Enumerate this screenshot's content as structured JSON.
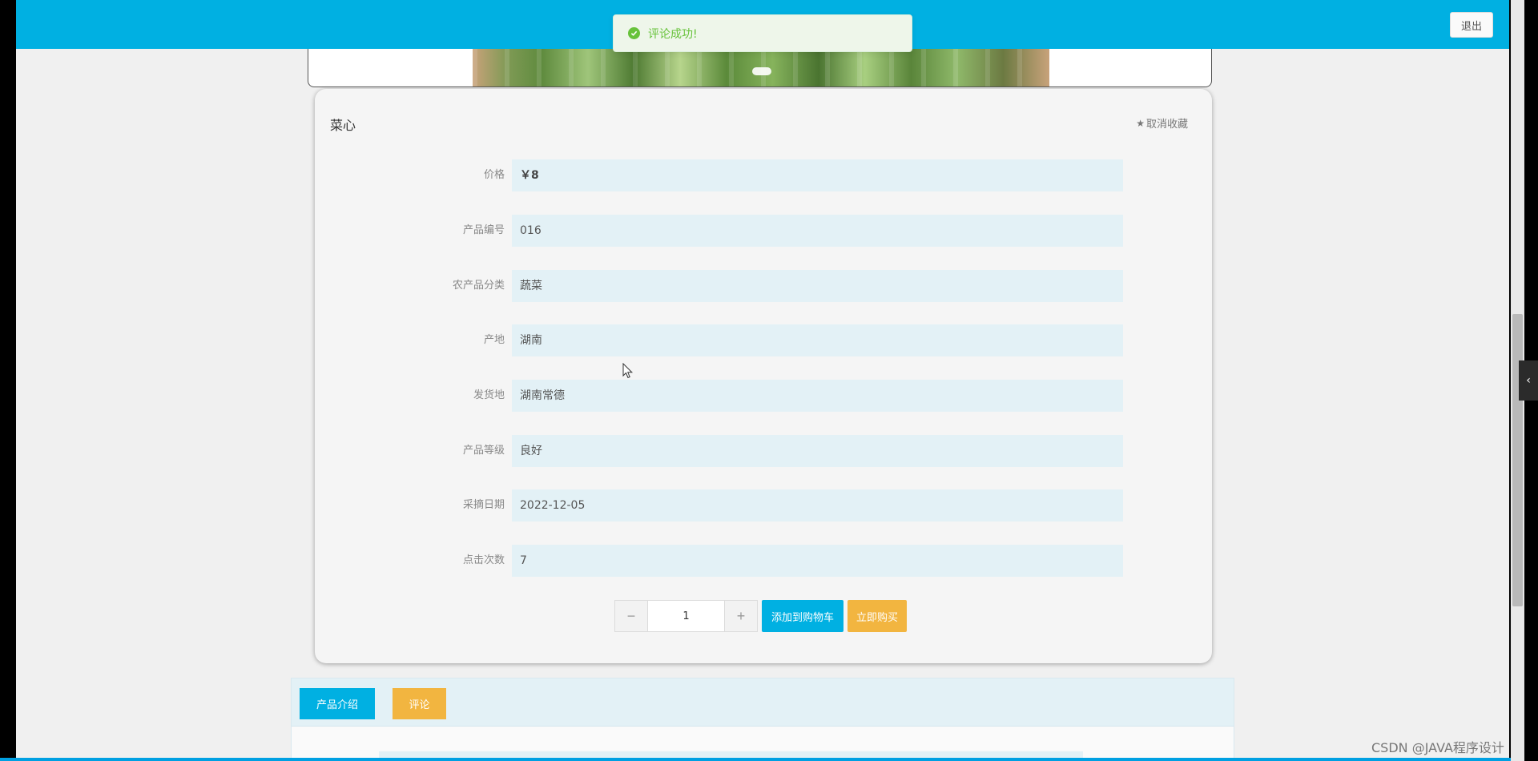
{
  "topbar": {
    "logout_label": "退出",
    "accent": "#00b0e2"
  },
  "toast": {
    "message": "评论成功!",
    "icon": "check-circle-icon",
    "color": "#67c23a"
  },
  "product": {
    "name": "菜心",
    "favorite_label": "取消收藏",
    "fields": [
      {
        "label": "价格",
        "value": "￥8"
      },
      {
        "label": "产品编号",
        "value": "016"
      },
      {
        "label": "农产品分类",
        "value": "蔬菜"
      },
      {
        "label": "产地",
        "value": "湖南"
      },
      {
        "label": "发货地",
        "value": "湖南常德"
      },
      {
        "label": "产品等级",
        "value": "良好"
      },
      {
        "label": "采摘日期",
        "value": "2022-12-05"
      },
      {
        "label": "点击次数",
        "value": "7"
      }
    ],
    "quantity": "1",
    "minus_symbol": "−",
    "plus_symbol": "+",
    "add_to_cart_label": "添加到购物车",
    "buy_now_label": "立即购买"
  },
  "tabs": {
    "intro_label": "产品介绍",
    "comments_label": "评论"
  },
  "watermark": "CSDN @JAVA程序设计",
  "drawer_toggle_symbol": "‹"
}
